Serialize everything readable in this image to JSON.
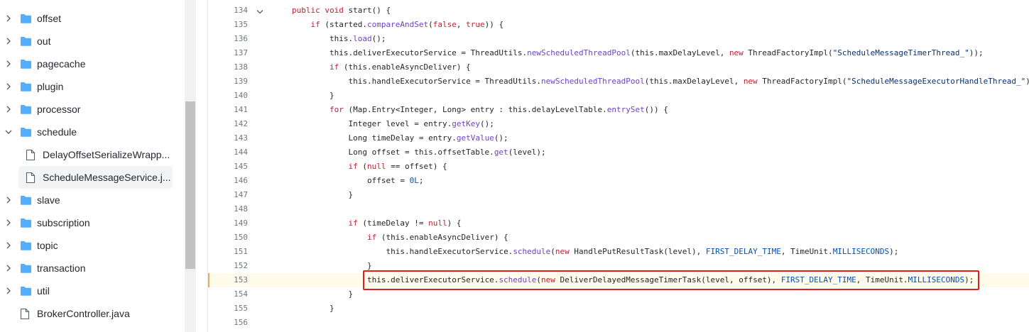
{
  "tree": {
    "items": [
      {
        "label": "offset",
        "kind": "folder",
        "expanded": false
      },
      {
        "label": "out",
        "kind": "folder",
        "expanded": false
      },
      {
        "label": "pagecache",
        "kind": "folder",
        "expanded": false
      },
      {
        "label": "plugin",
        "kind": "folder",
        "expanded": false
      },
      {
        "label": "processor",
        "kind": "folder",
        "expanded": false
      },
      {
        "label": "schedule",
        "kind": "folder",
        "expanded": true
      },
      {
        "label": "DelayOffsetSerializeWrapp...",
        "kind": "file"
      },
      {
        "label": "ScheduleMessageService.j...",
        "kind": "file",
        "selected": true
      },
      {
        "label": "slave",
        "kind": "folder",
        "expanded": false
      },
      {
        "label": "subscription",
        "kind": "folder",
        "expanded": false
      },
      {
        "label": "topic",
        "kind": "folder",
        "expanded": false
      },
      {
        "label": "transaction",
        "kind": "folder",
        "expanded": false
      },
      {
        "label": "util",
        "kind": "folder",
        "expanded": false
      },
      {
        "label": "BrokerController.java",
        "kind": "file"
      }
    ]
  },
  "code": {
    "highlighted_line": "153",
    "lines": [
      {
        "num": "134",
        "indent": 0,
        "fold": true,
        "tokens": [
          [
            "kw",
            "public"
          ],
          [
            "t",
            " "
          ],
          [
            "kw",
            "void"
          ],
          [
            "t",
            " start() {"
          ]
        ]
      },
      {
        "num": "135",
        "indent": 1,
        "tokens": [
          [
            "kw",
            "if"
          ],
          [
            "t",
            " (started."
          ],
          [
            "mt",
            "compareAndSet"
          ],
          [
            "t",
            "("
          ],
          [
            "kw",
            "false"
          ],
          [
            "t",
            ", "
          ],
          [
            "kw",
            "true"
          ],
          [
            "t",
            ")) {"
          ]
        ]
      },
      {
        "num": "136",
        "indent": 2,
        "tokens": [
          [
            "t",
            "this."
          ],
          [
            "mt",
            "load"
          ],
          [
            "t",
            "();"
          ]
        ]
      },
      {
        "num": "137",
        "indent": 2,
        "tokens": [
          [
            "t",
            "this.deliverExecutorService = ThreadUtils."
          ],
          [
            "mt",
            "newScheduledThreadPool"
          ],
          [
            "t",
            "(this.maxDelayLevel, "
          ],
          [
            "kw",
            "new"
          ],
          [
            "t",
            " ThreadFactoryImpl("
          ],
          [
            "st",
            "\"ScheduleMessageTimerThread_\""
          ],
          [
            "t",
            "));"
          ]
        ]
      },
      {
        "num": "138",
        "indent": 2,
        "tokens": [
          [
            "kw",
            "if"
          ],
          [
            "t",
            " (this.enableAsyncDeliver) {"
          ]
        ]
      },
      {
        "num": "139",
        "indent": 3,
        "tokens": [
          [
            "t",
            "this.handleExecutorService = ThreadUtils."
          ],
          [
            "mt",
            "newScheduledThreadPool"
          ],
          [
            "t",
            "(this.maxDelayLevel, "
          ],
          [
            "kw",
            "new"
          ],
          [
            "t",
            " ThreadFactoryImpl("
          ],
          [
            "st",
            "\"ScheduleMessageExecutorHandleThread_\""
          ],
          [
            "t",
            "));"
          ]
        ]
      },
      {
        "num": "140",
        "indent": 2,
        "tokens": [
          [
            "t",
            "}"
          ]
        ]
      },
      {
        "num": "141",
        "indent": 2,
        "tokens": [
          [
            "kw",
            "for"
          ],
          [
            "t",
            " (Map.Entry<Integer, Long> entry : this.delayLevelTable."
          ],
          [
            "mt",
            "entrySet"
          ],
          [
            "t",
            "()) {"
          ]
        ]
      },
      {
        "num": "142",
        "indent": 3,
        "tokens": [
          [
            "t",
            "Integer level = entry."
          ],
          [
            "mt",
            "getKey"
          ],
          [
            "t",
            "();"
          ]
        ]
      },
      {
        "num": "143",
        "indent": 3,
        "tokens": [
          [
            "t",
            "Long timeDelay = entry."
          ],
          [
            "mt",
            "getValue"
          ],
          [
            "t",
            "();"
          ]
        ]
      },
      {
        "num": "144",
        "indent": 3,
        "tokens": [
          [
            "t",
            "Long offset = this.offsetTable."
          ],
          [
            "mt",
            "get"
          ],
          [
            "t",
            "(level);"
          ]
        ]
      },
      {
        "num": "145",
        "indent": 3,
        "tokens": [
          [
            "kw",
            "if"
          ],
          [
            "t",
            " ("
          ],
          [
            "kw",
            "null"
          ],
          [
            "t",
            " == offset) {"
          ]
        ]
      },
      {
        "num": "146",
        "indent": 4,
        "tokens": [
          [
            "t",
            "offset = "
          ],
          [
            "cn",
            "0L"
          ],
          [
            "t",
            ";"
          ]
        ]
      },
      {
        "num": "147",
        "indent": 3,
        "tokens": [
          [
            "t",
            "}"
          ]
        ]
      },
      {
        "num": "148",
        "indent": 0,
        "tokens": []
      },
      {
        "num": "149",
        "indent": 3,
        "tokens": [
          [
            "kw",
            "if"
          ],
          [
            "t",
            " (timeDelay != "
          ],
          [
            "kw",
            "null"
          ],
          [
            "t",
            ") {"
          ]
        ]
      },
      {
        "num": "150",
        "indent": 4,
        "tokens": [
          [
            "kw",
            "if"
          ],
          [
            "t",
            " (this.enableAsyncDeliver) {"
          ]
        ]
      },
      {
        "num": "151",
        "indent": 5,
        "tokens": [
          [
            "t",
            "this.handleExecutorService."
          ],
          [
            "mt",
            "schedule"
          ],
          [
            "t",
            "("
          ],
          [
            "kw",
            "new"
          ],
          [
            "t",
            " HandlePutResultTask(level), "
          ],
          [
            "cn",
            "FIRST_DELAY_TIME"
          ],
          [
            "t",
            ", TimeUnit."
          ],
          [
            "cn",
            "MILLISECONDS"
          ],
          [
            "t",
            ");"
          ]
        ]
      },
      {
        "num": "152",
        "indent": 4,
        "tokens": [
          [
            "t",
            "}"
          ]
        ]
      },
      {
        "num": "153",
        "indent": 4,
        "tokens": [
          [
            "t",
            "this.deliverExecutorService."
          ],
          [
            "mt",
            "schedule"
          ],
          [
            "t",
            "("
          ],
          [
            "kw",
            "new"
          ],
          [
            "t",
            " DeliverDelayedMessageTimerTask(level, offset), "
          ],
          [
            "cn",
            "FIRST_DELAY_TIME"
          ],
          [
            "t",
            ", TimeUnit."
          ],
          [
            "cn",
            "MILLISECONDS"
          ],
          [
            "t",
            ");"
          ]
        ]
      },
      {
        "num": "154",
        "indent": 3,
        "tokens": [
          [
            "t",
            "}"
          ]
        ]
      },
      {
        "num": "155",
        "indent": 2,
        "tokens": [
          [
            "t",
            "}"
          ]
        ]
      },
      {
        "num": "156",
        "indent": 0,
        "tokens": []
      }
    ]
  },
  "colors": {
    "keyword": "#c21f30",
    "method": "#6f42c1",
    "constant": "#0550ae",
    "string": "#0a3069",
    "folder": "#54aeff",
    "highlight_bg": "#fffbea",
    "annotation_box": "#e41c1c"
  },
  "icons": {
    "folder": "folder-icon",
    "file": "file-icon",
    "chevron_right": "chevron-right-icon",
    "chevron_down": "chevron-down-icon"
  }
}
